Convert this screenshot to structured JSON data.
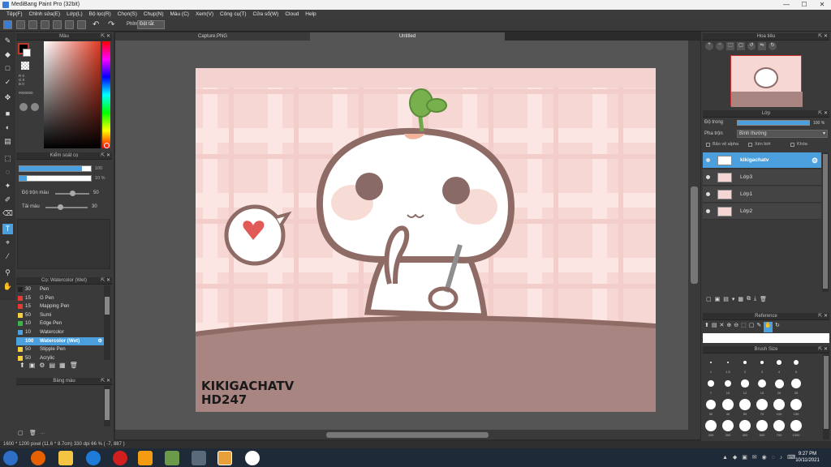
{
  "window": {
    "title": "MediBang Paint Pro (32bit)",
    "minimize": "—",
    "maximize": "☐",
    "close": "✕"
  },
  "menu": [
    "Tệp(F)",
    "Chỉnh sửa(E)",
    "Lớp(L)",
    "Bộ lọc(R)",
    "Chọn(S)",
    "Chụp(N)",
    "Màu (C)",
    "Xem(V)",
    "Công cụ(T)",
    "Cửa sổ(W)",
    "Cloud",
    "Help"
  ],
  "toolbar": {
    "snap_label": "Phỉm:",
    "snap_value": "Đệt tắt"
  },
  "tabs": {
    "tab1": "Capture.PNG",
    "tab2": "Untitled"
  },
  "color_panel": {
    "title": "Màu",
    "hex": "#000000",
    "r": "R 0",
    "g": "G 0",
    "b": "B 0"
  },
  "brush_control": {
    "title": "Kiểm soát cọ",
    "size_value": "100",
    "opacity_value": "10 %",
    "blend_label": "Độ trộn màu",
    "blend_value": "50",
    "amount_label": "Tải màu",
    "amount_value": "30"
  },
  "brush_list": {
    "title": "Cọ: Watercolor (Wet)",
    "items": [
      {
        "size": "30",
        "name": "Pen",
        "color": "#222222"
      },
      {
        "size": "15",
        "name": "G Pen",
        "color": "#e53935"
      },
      {
        "size": "15",
        "name": "Mapping Pen",
        "color": "#e53935"
      },
      {
        "size": "50",
        "name": "Sumi",
        "color": "#f4d03f"
      },
      {
        "size": "10",
        "name": "Edge Pen",
        "color": "#3cb44b"
      },
      {
        "size": "10",
        "name": "Watercolor",
        "color": "#4aa3df"
      },
      {
        "size": "100",
        "name": "Watercolor (Wet)",
        "color": "#4aa3df"
      },
      {
        "size": "50",
        "name": "Stipple Pen",
        "color": "#f4d03f"
      },
      {
        "size": "50",
        "name": "Acrylic",
        "color": "#f4d03f"
      }
    ]
  },
  "palette_panel": {
    "title": "Bảng màu",
    "footer": "..."
  },
  "navigator": {
    "title": "Hoa tiêu"
  },
  "layer_panel": {
    "title": "Lớp",
    "opacity_label": "Độ trong",
    "opacity_value": "100 %",
    "opacity_fraction": 1.0,
    "blend_label": "Pha trộn",
    "blend_value": "Bình thường",
    "protect_alpha": "Bảo vệ alpha",
    "clipping": "Xén bớt",
    "lock": "Khóa",
    "layers": [
      {
        "name": "kikigachatv",
        "active": true
      },
      {
        "name": "Lớp3",
        "active": false
      },
      {
        "name": "Lớp1",
        "active": false
      },
      {
        "name": "Lớp2",
        "active": false
      }
    ]
  },
  "reference": {
    "title": "Reference"
  },
  "brush_size": {
    "title": "Brush Size",
    "labels": [
      "1",
      "1.5",
      "2",
      "3",
      "4",
      "5",
      "7",
      "10",
      "12",
      "15",
      "20",
      "25",
      "30",
      "40",
      "50",
      "70",
      "100",
      "150",
      "200",
      "300",
      "400",
      "500",
      "700",
      "1000"
    ]
  },
  "canvas": {
    "watermark_line1": "KIKIGACHATV",
    "watermark_line2": "HD247"
  },
  "status": {
    "text": "1600 * 1200 pixel  (11.6 * 8.7cm)  330 dpi  66 %  ( -7, 887 )"
  },
  "taskbar": {
    "time": "9:27 PM",
    "date": "10/11/2021"
  },
  "colors": {
    "accent": "#4a9fdc",
    "canvas_bg": "#f7d9d6",
    "ground": "#a98582"
  }
}
